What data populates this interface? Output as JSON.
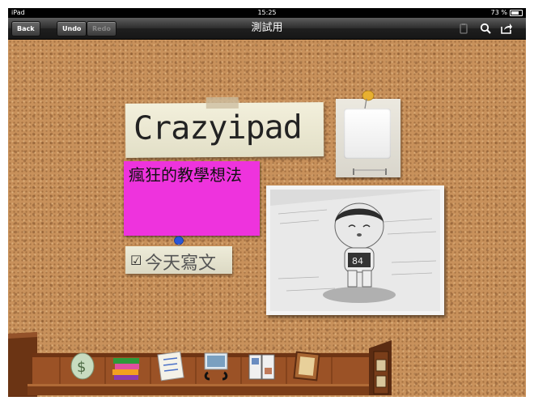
{
  "status_bar": {
    "device": "iPad",
    "time": "15:25",
    "battery": "73 %"
  },
  "nav": {
    "back": "Back",
    "undo": "Undo",
    "redo": "Redo",
    "title": "測試用"
  },
  "notes": {
    "title": "Crazyipad",
    "pink": "瘋狂的教學想法",
    "checklist_item": "今天寫文",
    "checkmark": "☑"
  },
  "icons": [
    "clipboard-icon",
    "search-icon",
    "share-icon"
  ],
  "dock_items": [
    "money-icon",
    "books-icon",
    "checklist-icon",
    "photo-clip-icon",
    "magazine-icon",
    "frame-icon",
    "cabinet-icon"
  ]
}
